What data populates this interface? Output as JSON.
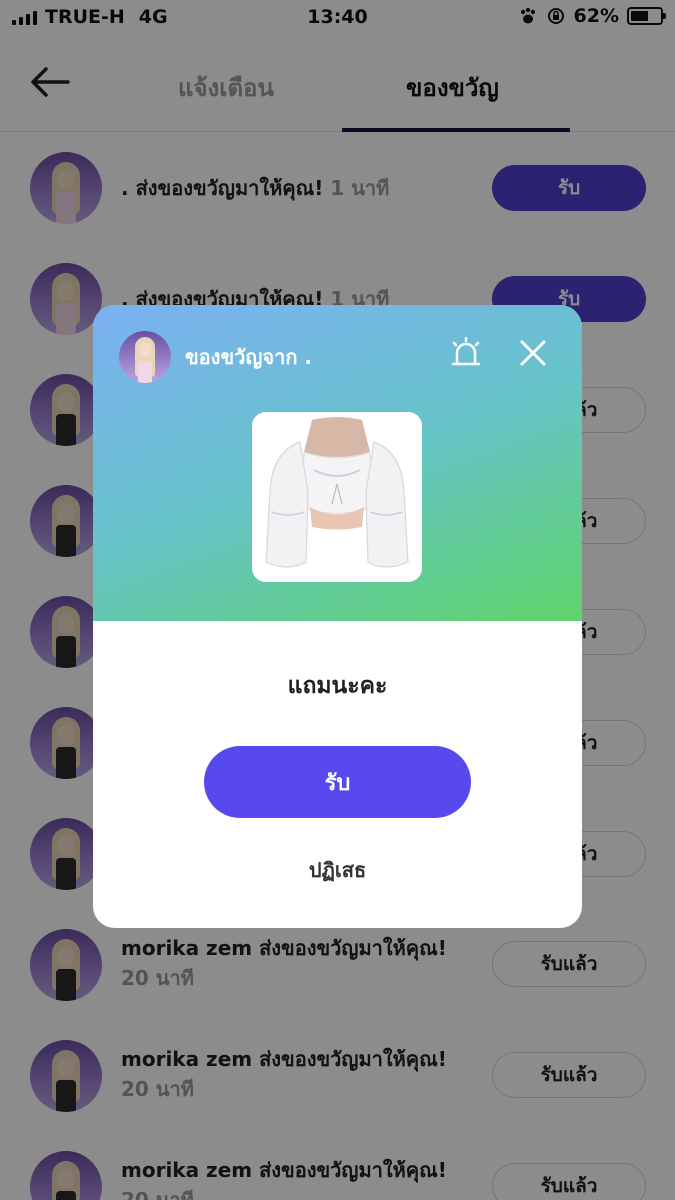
{
  "status": {
    "carrier": "TRUE-H",
    "network": "4G",
    "time": "13:40",
    "battery": "62%",
    "battery_level": 0.62
  },
  "header": {
    "tab_notifications": "แจ้งเตือน",
    "tab_gifts": "ของขวัญ"
  },
  "list": [
    {
      "sender": ".",
      "message": "ส่งของขวัญมาให้คุณ!",
      "time": "1 นาที",
      "button": "รับ"
    },
    {
      "sender": ".",
      "message": "ส่งของขวัญมาให้คุณ!",
      "time": "1 นาที",
      "button": "รับ"
    },
    {
      "button": "รับแล้ว"
    },
    {
      "button": "รับแล้ว"
    },
    {
      "button": "รับแล้ว"
    },
    {
      "button": "รับแล้ว"
    },
    {
      "button": "รับแล้ว"
    },
    {
      "sender": "morika zem",
      "message": "ส่งของขวัญมาให้คุณ!",
      "time": "20 นาที",
      "button": "รับแล้ว"
    },
    {
      "sender": "morika zem",
      "message": "ส่งของขวัญมาให้คุณ!",
      "time": "20 นาที",
      "button": "รับแล้ว"
    },
    {
      "sender": "morika zem",
      "message": "ส่งของขวัญมาให้คุณ!",
      "time": "20 นาที",
      "button": "รับแล้ว"
    }
  ],
  "modal": {
    "from_label": "ของขวัญจาก .",
    "message": "แถมนะคะ",
    "accept": "รับ",
    "decline": "ปฏิเสธ"
  },
  "colors": {
    "accent": "#4f3fcf",
    "modal_button": "#5849ee",
    "gradient_start": "#7bb0f2",
    "gradient_end": "#5fd46a"
  }
}
